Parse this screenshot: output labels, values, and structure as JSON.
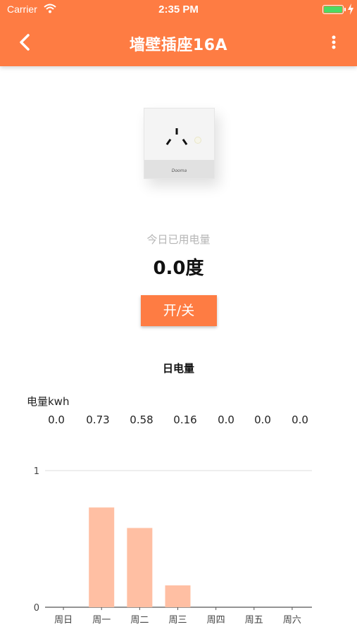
{
  "status_bar": {
    "carrier": "Carrier",
    "time": "2:35 PM",
    "battery_color": "#4cd964"
  },
  "nav": {
    "title": "墙壁插座16A",
    "back_icon": "chevron-left-icon",
    "more_icon": "more-vertical-icon",
    "bar_color": "#fe7c43"
  },
  "device": {
    "image_icon": "wall-socket-image",
    "brand_text": "Dooma"
  },
  "usage": {
    "today_label": "今日已用电量",
    "today_value": "0.0度"
  },
  "toggle_button": {
    "label": "开/关"
  },
  "chart": {
    "title": "日电量",
    "unit_label": "电量kwh",
    "value_labels": [
      "0.0",
      "0.73",
      "0.58",
      "0.16",
      "0.0",
      "0.0",
      "0.0"
    ]
  },
  "chart_data": {
    "type": "bar",
    "title": "日电量",
    "ylabel": "电量kwh",
    "xlabel": "",
    "categories": [
      "周日",
      "周一",
      "周二",
      "周三",
      "周四",
      "周五",
      "周六"
    ],
    "values": [
      0.0,
      0.73,
      0.58,
      0.16,
      0.0,
      0.0,
      0.0
    ],
    "ylim": [
      0,
      1
    ],
    "yticks": [
      "0",
      "1"
    ],
    "grid": true,
    "bar_color": "#ffbfa3",
    "legend": "none"
  }
}
